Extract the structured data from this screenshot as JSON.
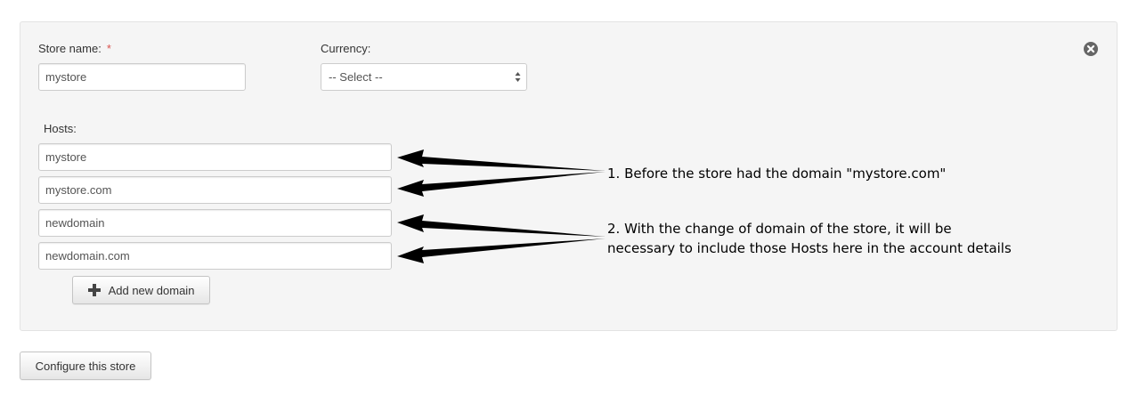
{
  "form": {
    "store_name_label": "Store name:",
    "required_mark": "*",
    "store_name_value": "mystore",
    "currency_label": "Currency:",
    "currency_selected": "-- Select --",
    "hosts_label": "Hosts:",
    "hosts": [
      "mystore",
      "mystore.com",
      "newdomain",
      "newdomain.com"
    ],
    "add_domain_label": "Add new domain",
    "configure_label": "Configure this store"
  },
  "annotations": {
    "note1": "1. Before the store had the domain \"mystore.com\"",
    "note2_line1": "2. With the change of domain of the store, it will be",
    "note2_line2": "necessary to include those Hosts here in the account details"
  },
  "colors": {
    "panel_bg": "#f5f5f5",
    "required": "#d9534f",
    "arrow": "#000000"
  },
  "icons": {
    "close": "close-circle-icon",
    "add": "plus-icon",
    "select_caret": "up-down-caret-icon"
  }
}
